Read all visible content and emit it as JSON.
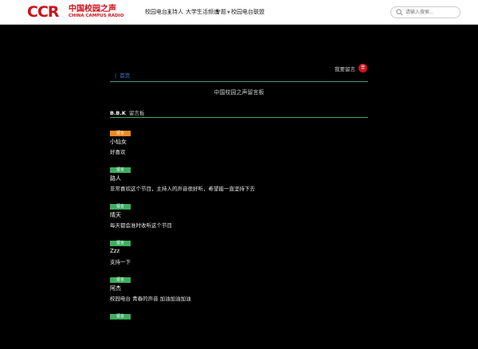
{
  "header": {
    "logo": {
      "brand": "CCR",
      "chinese_name": "中国校园之声",
      "english_name": "CHINA CAMPUS RADIO"
    },
    "nav": [
      {
        "label": "校园电台",
        "has_dropdown": true
      },
      {
        "label": "主持人",
        "has_dropdown": false
      },
      {
        "label": "大学生活频道",
        "has_dropdown": false
      },
      {
        "label": "专题",
        "has_dropdown": true
      },
      {
        "label": "校园电台联盟",
        "has_dropdown": false
      }
    ],
    "search": {
      "placeholder": "请输入搜索..."
    }
  },
  "main": {
    "login": {
      "label": "我要留言",
      "button_label": "登"
    },
    "breadcrumb": {
      "separator": "|",
      "current": "首页"
    },
    "page_title": "中国校园之声留言板",
    "message_board": {
      "brand": "B.B.K",
      "title": "留言板"
    },
    "comments": [
      {
        "tag": "留言",
        "tag_color": "#f08a24",
        "author": "小仙女",
        "text": "好喜欢"
      },
      {
        "tag": "留言",
        "tag_color": "#3fae60",
        "author": "路人",
        "text": "非常喜欢这个节目，主持人的声音很好听，希望能一直坚持下去"
      },
      {
        "tag": "留言",
        "tag_color": "#3fae60",
        "author": "晴天",
        "text": "每天都会准时收听这个节目"
      },
      {
        "tag": "留言",
        "tag_color": "#3fae60",
        "author": "Zzz",
        "text": "支持一下"
      },
      {
        "tag": "留言",
        "tag_color": "#3fae60",
        "author": "阿杰",
        "text": "校园电台 青春的声音 加油加油加油"
      },
      {
        "tag": "留言",
        "tag_color": "#3fae60",
        "author": "",
        "text": ""
      }
    ]
  },
  "icons": {
    "search": "search-icon",
    "caret": "chevron-down-icon"
  },
  "colors": {
    "brand_red": "#d0121b",
    "tag_green": "#3fae60",
    "tag_orange": "#f08a24",
    "divider_teal": "#5b8c87",
    "link_blue": "#3a7fd0"
  }
}
